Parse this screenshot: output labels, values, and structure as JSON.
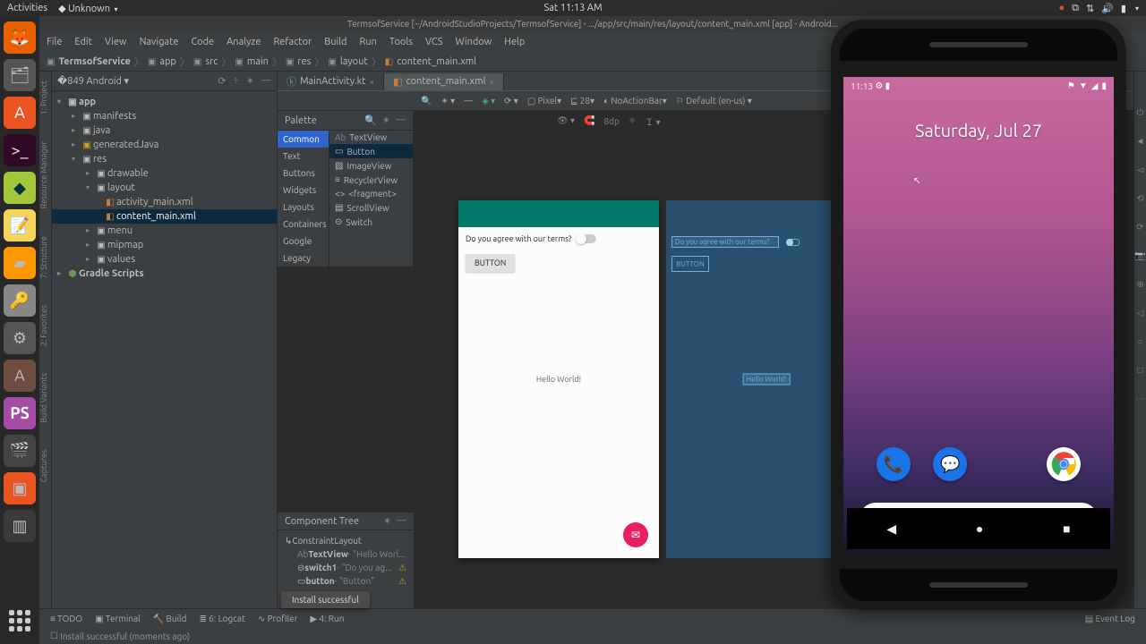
{
  "ubuntu": {
    "activities": "Activities",
    "app": "Unknown",
    "clock": "Sat 11:13 AM"
  },
  "ide": {
    "title": "TermsofService [~/AndroidStudioProjects/TermsofService] - .../app/src/main/res/layout/content_main.xml [app] - Android...",
    "menu": [
      "File",
      "Edit",
      "View",
      "Navigate",
      "Code",
      "Analyze",
      "Refactor",
      "Build",
      "Run",
      "Tools",
      "VCS",
      "Window",
      "Help"
    ],
    "breadcrumb": [
      "TermsofService",
      "app",
      "src",
      "main",
      "res",
      "layout",
      "content_main.xml"
    ],
    "project_label": "Android",
    "tree": {
      "app": "app",
      "manifests": "manifests",
      "java": "java",
      "generated": "generatedJava",
      "res": "res",
      "drawable": "drawable",
      "layout": "layout",
      "activity": "activity_main.xml",
      "content": "content_main.xml",
      "menu": "menu",
      "mipmap": "mipmap",
      "values": "values",
      "gradle": "Gradle Scripts"
    },
    "tabs": {
      "main": "MainActivity.kt",
      "content": "content_main.xml"
    },
    "toolbar": {
      "device": "Pixel",
      "api": "28",
      "theme": "NoActionBar",
      "locale": "Default (en-us)",
      "dp": "8dp"
    },
    "palette": {
      "title": "Palette",
      "cats": [
        "Common",
        "Text",
        "Buttons",
        "Widgets",
        "Layouts",
        "Containers",
        "Google",
        "Legacy"
      ],
      "items": [
        "TextView",
        "Button",
        "ImageView",
        "RecyclerView",
        "<fragment>",
        "ScrollView",
        "Switch"
      ]
    },
    "ctree": {
      "title": "Component Tree",
      "root": "ConstraintLayout",
      "textview": "TextView",
      "textview_val": " - \"Hello Worl...",
      "switch": "switch1",
      "switch_val": " - \"Do you ag...",
      "button": "button",
      "button_val": " - \"Button\""
    },
    "preview": {
      "terms": "Do you agree with our terms?",
      "button": "BUTTON",
      "hello": "Hello World!"
    },
    "bottom": {
      "todo": "TODO",
      "terminal": "Terminal",
      "build": "Build",
      "logcat": "Logcat",
      "profiler": "Profiler",
      "run": "Run",
      "eventlog": "Event Log"
    },
    "toast": "Install successful",
    "status": "Install successful (moments ago)"
  },
  "emulator": {
    "time": "11:13",
    "date": "Saturday, Jul 27"
  }
}
